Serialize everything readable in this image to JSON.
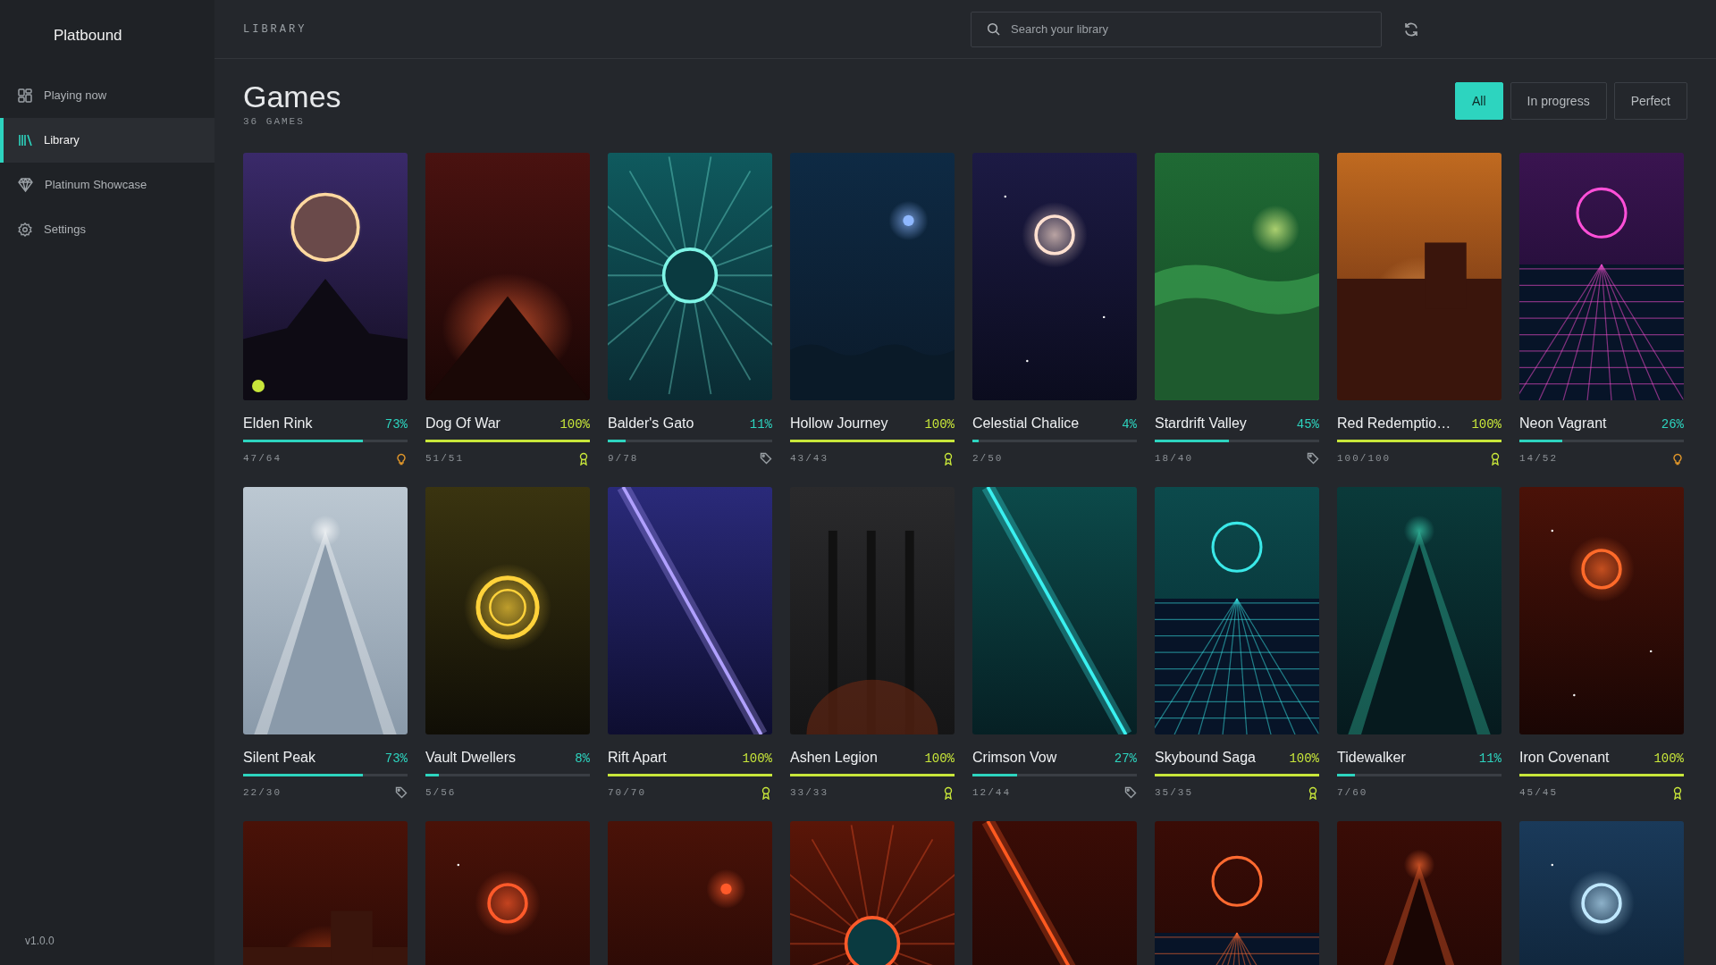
{
  "app": {
    "title": "Platbound",
    "version": "v1.0.0"
  },
  "sidebar": {
    "items": [
      {
        "label": "Playing now",
        "selected": false
      },
      {
        "label": "Library",
        "selected": true
      },
      {
        "label": "Platinum Showcase",
        "selected": false
      },
      {
        "label": "Settings",
        "selected": false
      }
    ]
  },
  "header": {
    "section": "LIBRARY",
    "search": {
      "placeholder": "Search your library"
    }
  },
  "page": {
    "title": "Games",
    "count": "36 GAMES"
  },
  "filters": [
    {
      "label": "All",
      "selected": true
    },
    {
      "label": "In progress",
      "selected": false
    },
    {
      "label": "Perfect",
      "selected": false
    }
  ],
  "games": [
    {
      "title": "Elden Rink",
      "percent": "73%",
      "level": 0.73,
      "trophies": "47/64",
      "kind": "hint",
      "playing": true
    },
    {
      "title": "Dog Of War",
      "percent": "100%",
      "level": 1,
      "trophies": "51/51",
      "kind": "award",
      "playing": false
    },
    {
      "title": "Balder's Gato",
      "percent": "11%",
      "level": 0.11,
      "trophies": "9/78",
      "kind": "tag",
      "playing": false
    },
    {
      "title": "Hollow Journey",
      "percent": "100%",
      "level": 1,
      "trophies": "43/43",
      "kind": "award",
      "playing": false
    },
    {
      "title": "Celestial Chalice",
      "percent": "4%",
      "level": 0.04,
      "trophies": "2/50",
      "kind": "plain",
      "playing": false
    },
    {
      "title": "Stardrift Valley",
      "percent": "45%",
      "level": 0.45,
      "trophies": "18/40",
      "kind": "tag",
      "playing": false
    },
    {
      "title": "Red Redemptio…",
      "percent": "100%",
      "level": 1,
      "trophies": "100/100",
      "kind": "award",
      "playing": false
    },
    {
      "title": "Neon Vagrant",
      "percent": "26%",
      "level": 0.26,
      "trophies": "14/52",
      "kind": "hint",
      "playing": false
    },
    {
      "title": "Silent Peak",
      "percent": "73%",
      "level": 0.73,
      "trophies": "22/30",
      "kind": "tag",
      "playing": false
    },
    {
      "title": "Vault Dwellers",
      "percent": "8%",
      "level": 0.08,
      "trophies": "5/56",
      "kind": "plain",
      "playing": false
    },
    {
      "title": "Rift Apart",
      "percent": "100%",
      "level": 1,
      "trophies": "70/70",
      "kind": "award",
      "playing": false
    },
    {
      "title": "Ashen Legion",
      "percent": "100%",
      "level": 1,
      "trophies": "33/33",
      "kind": "award",
      "playing": false
    },
    {
      "title": "Crimson Vow",
      "percent": "27%",
      "level": 0.27,
      "trophies": "12/44",
      "kind": "tag",
      "playing": false
    },
    {
      "title": "Skybound Saga",
      "percent": "100%",
      "level": 1,
      "trophies": "35/35",
      "kind": "award",
      "playing": false
    },
    {
      "title": "Tidewalker",
      "percent": "11%",
      "level": 0.11,
      "trophies": "7/60",
      "kind": "plain",
      "playing": false
    },
    {
      "title": "Iron Covenant",
      "percent": "100%",
      "level": 1,
      "trophies": "45/45",
      "kind": "award",
      "playing": false
    }
  ]
}
